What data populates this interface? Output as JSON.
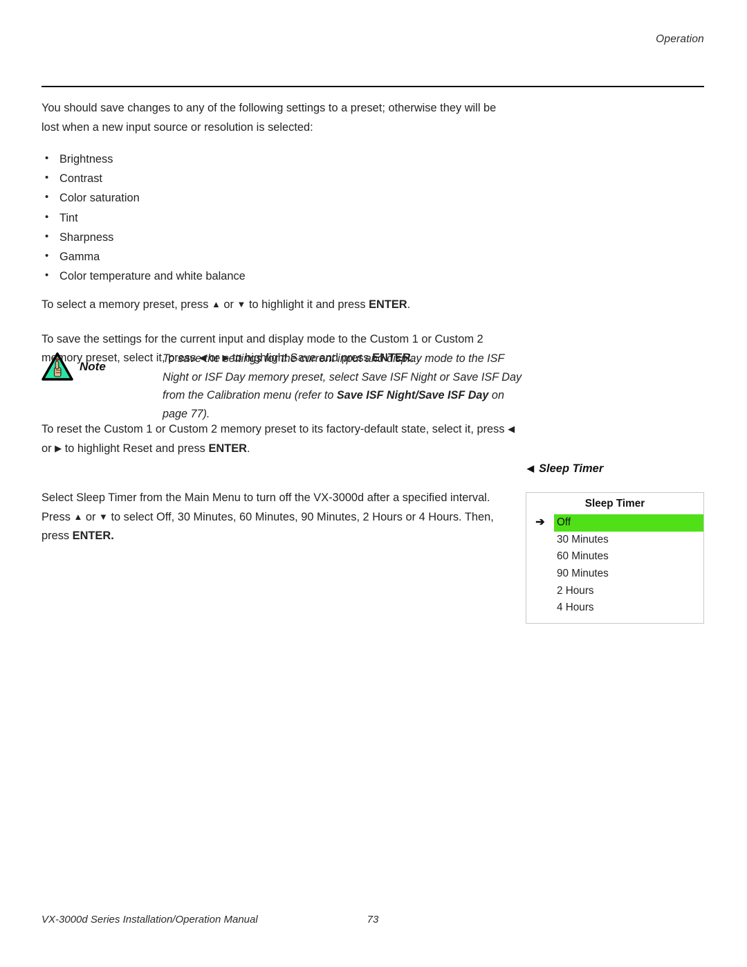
{
  "header": {
    "section_title": "Operation"
  },
  "intro": {
    "paragraph": "You should save changes to any of the following settings to a preset; otherwise they will be lost when a new input source or resolution is selected:"
  },
  "settings_list": [
    "Brightness",
    "Contrast",
    "Color saturation",
    "Tint",
    "Sharpness",
    "Gamma",
    "Color temperature and white balance"
  ],
  "instructions": {
    "select_preset": {
      "part1": "To select a memory preset, press ",
      "up_arrow": "▲",
      "part2": " or ",
      "down_arrow": "▼",
      "part3": " to highlight it and press ",
      "enter": "ENTER",
      "part4": "."
    },
    "save_preset": {
      "part1": "To save the settings for the current input and display mode to the Custom 1 or Custom 2 memory preset, select it, press ",
      "left_arrow": "◀",
      "part2": " or ",
      "right_arrow": "▶",
      "part3": " to highlight Save and press ",
      "enter": "ENTER",
      "part4": "."
    },
    "reset_preset": {
      "part1": "To reset the Custom 1 or Custom 2 memory preset to its factory-default state, select it, press ",
      "left_arrow": "◀",
      "part2": " or ",
      "right_arrow": "▶",
      "part3": " to highlight Reset and press ",
      "enter": "ENTER",
      "part4": "."
    },
    "sleep_timer": {
      "part1": "Select Sleep Timer from the Main Menu to turn off the VX-3000d after a specified interval. Press ",
      "up_arrow": "▲",
      "part2": " or ",
      "down_arrow": "▼",
      "part3": " to select Off, 30 Minutes, 60 Minutes, 90 Minutes, 2 Hours or 4 Hours. Then, press ",
      "enter": "ENTER.",
      "part4": ""
    }
  },
  "note": {
    "label": "Note",
    "icon": "note-triangle-hand-icon",
    "text_part1": "To save the settings for the current input and display mode to the ISF Night or ISF Day memory preset, select Save ISF Night or Save ISF Day from the Calibration menu (refer to ",
    "text_bold": "Save ISF Night/Save ISF Day",
    "text_part2": " on page 77)."
  },
  "callout": {
    "arrow": "◀",
    "label": "Sleep Timer"
  },
  "osd_menu": {
    "title": "Sleep Timer",
    "selection_arrow": "➔",
    "highlight_color": "#50E017",
    "items": [
      {
        "label": "Off",
        "selected": true
      },
      {
        "label": "30 Minutes",
        "selected": false
      },
      {
        "label": "60 Minutes",
        "selected": false
      },
      {
        "label": "90 Minutes",
        "selected": false
      },
      {
        "label": "2 Hours",
        "selected": false
      },
      {
        "label": "4 Hours",
        "selected": false
      }
    ]
  },
  "footer": {
    "manual_title": "VX-3000d Series Installation/Operation Manual",
    "page_number": "73"
  }
}
